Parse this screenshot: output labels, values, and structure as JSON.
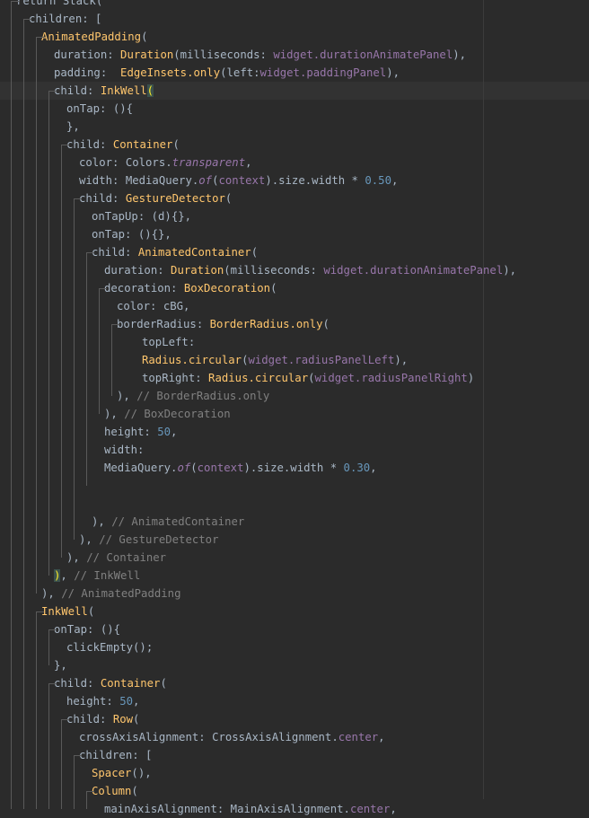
{
  "code_lines": [
    {
      "indent": 1,
      "tokens": [
        {
          "t": "return Stack("
        }
      ]
    },
    {
      "indent": 2,
      "tokens": [
        {
          "t": "children: ["
        }
      ]
    },
    {
      "indent": 3,
      "tokens": [
        {
          "t": "AnimatedPadding",
          "c": "cls"
        },
        {
          "t": "("
        }
      ]
    },
    {
      "indent": 4,
      "tokens": [
        {
          "t": "duration: "
        },
        {
          "t": "Duration",
          "c": "cls"
        },
        {
          "t": "(milliseconds: "
        },
        {
          "t": "widget.durationAnimatePanel",
          "c": "purple"
        },
        {
          "t": "),"
        }
      ]
    },
    {
      "indent": 4,
      "tokens": [
        {
          "t": "padding:  "
        },
        {
          "t": "EdgeInsets.only",
          "c": "cls"
        },
        {
          "t": "(left:"
        },
        {
          "t": "widget.paddingPanel",
          "c": "purple"
        },
        {
          "t": "),"
        }
      ]
    },
    {
      "indent": 4,
      "current": true,
      "tokens": [
        {
          "t": "child: "
        },
        {
          "t": "InkWell",
          "c": "cls"
        },
        {
          "t": "(",
          "c": "hl"
        }
      ]
    },
    {
      "indent": 5,
      "tokens": [
        {
          "t": "onTap: (){"
        }
      ]
    },
    {
      "indent": 5,
      "tokens": [
        {
          "t": "},"
        }
      ]
    },
    {
      "indent": 5,
      "tokens": [
        {
          "t": "child: "
        },
        {
          "t": "Container",
          "c": "cls"
        },
        {
          "t": "("
        }
      ]
    },
    {
      "indent": 6,
      "tokens": [
        {
          "t": "color: Colors."
        },
        {
          "t": "transparent",
          "c": "italic"
        },
        {
          "t": ","
        }
      ]
    },
    {
      "indent": 6,
      "tokens": [
        {
          "t": "width: MediaQuery."
        },
        {
          "t": "of",
          "c": "italic"
        },
        {
          "t": "("
        },
        {
          "t": "context",
          "c": "purple"
        },
        {
          "t": ").size.width * "
        },
        {
          "t": "0.50",
          "c": "num"
        },
        {
          "t": ","
        }
      ]
    },
    {
      "indent": 6,
      "tokens": [
        {
          "t": "child: "
        },
        {
          "t": "GestureDetector",
          "c": "cls"
        },
        {
          "t": "("
        }
      ]
    },
    {
      "indent": 7,
      "tokens": [
        {
          "t": "onTapUp: (d){},"
        }
      ]
    },
    {
      "indent": 7,
      "tokens": [
        {
          "t": "onTap: (){},"
        }
      ]
    },
    {
      "indent": 7,
      "tokens": [
        {
          "t": "child: "
        },
        {
          "t": "AnimatedContainer",
          "c": "cls"
        },
        {
          "t": "("
        }
      ]
    },
    {
      "indent": 8,
      "tokens": [
        {
          "t": "duration: "
        },
        {
          "t": "Duration",
          "c": "cls"
        },
        {
          "t": "(milliseconds: "
        },
        {
          "t": "widget.durationAnimatePanel",
          "c": "purple"
        },
        {
          "t": "),"
        }
      ]
    },
    {
      "indent": 8,
      "tokens": [
        {
          "t": "decoration: "
        },
        {
          "t": "BoxDecoration",
          "c": "cls"
        },
        {
          "t": "("
        }
      ]
    },
    {
      "indent": 9,
      "tokens": [
        {
          "t": "color: cBG,"
        }
      ]
    },
    {
      "indent": 9,
      "tokens": [
        {
          "t": "borderRadius: "
        },
        {
          "t": "BorderRadius.only",
          "c": "cls"
        },
        {
          "t": "("
        }
      ]
    },
    {
      "indent": 11,
      "tokens": [
        {
          "t": "topLeft:"
        }
      ]
    },
    {
      "indent": 11,
      "tokens": [
        {
          "t": "Radius.circular",
          "c": "cls"
        },
        {
          "t": "("
        },
        {
          "t": "widget.radiusPanelLeft",
          "c": "purple"
        },
        {
          "t": "),"
        }
      ]
    },
    {
      "indent": 11,
      "tokens": [
        {
          "t": "topRight: "
        },
        {
          "t": "Radius.circular",
          "c": "cls"
        },
        {
          "t": "("
        },
        {
          "t": "widget.radiusPanelRight",
          "c": "purple"
        },
        {
          "t": ")"
        }
      ]
    },
    {
      "indent": 9,
      "tokens": [
        {
          "t": "), "
        },
        {
          "t": "// BorderRadius.only",
          "c": "comment"
        }
      ]
    },
    {
      "indent": 8,
      "tokens": [
        {
          "t": "), "
        },
        {
          "t": "// BoxDecoration",
          "c": "comment"
        }
      ]
    },
    {
      "indent": 8,
      "tokens": [
        {
          "t": "height: "
        },
        {
          "t": "50",
          "c": "num"
        },
        {
          "t": ","
        }
      ]
    },
    {
      "indent": 8,
      "tokens": [
        {
          "t": "width:"
        }
      ]
    },
    {
      "indent": 8,
      "tokens": [
        {
          "t": "MediaQuery."
        },
        {
          "t": "of",
          "c": "italic"
        },
        {
          "t": "("
        },
        {
          "t": "context",
          "c": "purple"
        },
        {
          "t": ").size.width * "
        },
        {
          "t": "0.30",
          "c": "num"
        },
        {
          "t": ","
        }
      ]
    },
    {
      "indent": 8,
      "tokens": []
    },
    {
      "indent": 8,
      "tokens": []
    },
    {
      "indent": 7,
      "tokens": [
        {
          "t": "), "
        },
        {
          "t": "// AnimatedContainer",
          "c": "comment"
        }
      ]
    },
    {
      "indent": 6,
      "tokens": [
        {
          "t": "), "
        },
        {
          "t": "// GestureDetector",
          "c": "comment"
        }
      ]
    },
    {
      "indent": 5,
      "tokens": [
        {
          "t": "), "
        },
        {
          "t": "// Container",
          "c": "comment"
        }
      ]
    },
    {
      "indent": 4,
      "tokens": [
        {
          "t": ")",
          "c": "hl"
        },
        {
          "t": ", "
        },
        {
          "t": "// InkWell",
          "c": "comment"
        }
      ]
    },
    {
      "indent": 3,
      "tokens": [
        {
          "t": "), "
        },
        {
          "t": "// AnimatedPadding",
          "c": "comment"
        }
      ]
    },
    {
      "indent": 3,
      "tokens": [
        {
          "t": "InkWell",
          "c": "cls"
        },
        {
          "t": "("
        }
      ]
    },
    {
      "indent": 4,
      "tokens": [
        {
          "t": "onTap: (){"
        }
      ]
    },
    {
      "indent": 5,
      "tokens": [
        {
          "t": "clickEmpty();"
        }
      ]
    },
    {
      "indent": 4,
      "tokens": [
        {
          "t": "},"
        }
      ]
    },
    {
      "indent": 4,
      "tokens": [
        {
          "t": "child: "
        },
        {
          "t": "Container",
          "c": "cls"
        },
        {
          "t": "("
        }
      ]
    },
    {
      "indent": 5,
      "tokens": [
        {
          "t": "height: "
        },
        {
          "t": "50",
          "c": "num"
        },
        {
          "t": ","
        }
      ]
    },
    {
      "indent": 5,
      "tokens": [
        {
          "t": "child: "
        },
        {
          "t": "Row",
          "c": "cls"
        },
        {
          "t": "("
        }
      ]
    },
    {
      "indent": 6,
      "tokens": [
        {
          "t": "crossAxisAlignment: CrossAxisAlignment."
        },
        {
          "t": "center",
          "c": "purple"
        },
        {
          "t": ","
        }
      ]
    },
    {
      "indent": 6,
      "tokens": [
        {
          "t": "children: ["
        }
      ]
    },
    {
      "indent": 7,
      "tokens": [
        {
          "t": "Spacer",
          "c": "cls"
        },
        {
          "t": "(),"
        }
      ]
    },
    {
      "indent": 7,
      "tokens": [
        {
          "t": "Column",
          "c": "cls"
        },
        {
          "t": "("
        }
      ]
    },
    {
      "indent": 8,
      "tokens": [
        {
          "t": "mainAxisAlignment: MainAxisAlignment."
        },
        {
          "t": "center",
          "c": "purple"
        },
        {
          "t": ","
        }
      ]
    }
  ],
  "colors": {
    "background": "#2b2b2b",
    "current_line": "#323232",
    "default_text": "#a9b7c6",
    "class_name": "#ffc66d",
    "number": "#6897bb",
    "field": "#9876aa",
    "comment": "#808080",
    "brace_match_bg": "#3b514d",
    "brace_match_fg": "#ffef28",
    "guide": "#5a5a5a"
  }
}
